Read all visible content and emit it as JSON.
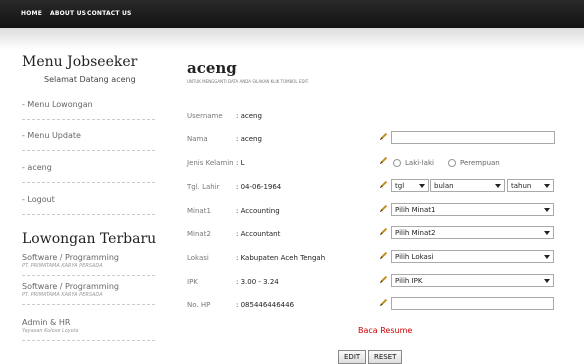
{
  "nav": [
    "HOME",
    "ABOUT US",
    "CONTACT US"
  ],
  "sidebar": {
    "title": "Menu Jobseeker",
    "subtitle": "Selamat Datang aceng",
    "items": [
      "- Menu Lowongan",
      "- Menu Update",
      "- aceng",
      "- Logout"
    ]
  },
  "lowongan": {
    "title": "Lowongan Terbaru",
    "jobs": [
      {
        "title": "Software / Programming",
        "company": "PT. PRIMATAMA KARYA PERSADA"
      },
      {
        "title": "Software / Programming",
        "company": "PT. PRIMATAMA KARYA PERSADA"
      },
      {
        "title": "Admin & HR",
        "company": "Yayasan Kolose Loyola"
      }
    ]
  },
  "main": {
    "title": "aceng",
    "note": "UNTUK MENGGANTI DATA ANDA SILAKAN KLIK TOMBOL EDIT.",
    "fields": [
      {
        "label": "Username",
        "value": ": aceng"
      },
      {
        "label": "Nama",
        "value": ": aceng"
      },
      {
        "label": "Jenis Kelamin",
        "value": ": L"
      },
      {
        "label": "Tgl. Lahir",
        "value": ": 04-06-1964"
      },
      {
        "label": "Minat1",
        "value": ": Accounting"
      },
      {
        "label": "Minat2",
        "value": ": Accountant"
      },
      {
        "label": "Lokasi",
        "value": ": Kabupaten Aceh Tengah"
      },
      {
        "label": "IPK",
        "value": ": 3.00 - 3.24"
      },
      {
        "label": "No. HP",
        "value": ": 085446446446"
      }
    ],
    "gender_options": [
      "Laki-laki",
      "Perempuan"
    ],
    "date_selects": [
      "tgl",
      "bulan",
      "tahun"
    ],
    "selects": {
      "minat1": "Pilih Minat1",
      "minat2": "Pilih Minat2",
      "lokasi": "Pilih Lokasi",
      "ipk": "Pilih IPK"
    },
    "resume_link": "Baca Resume",
    "edit_button": "EDIT",
    "reset_button": "RESET"
  },
  "colors": {
    "topbar": "#1a1a1a",
    "link": "#cc0000",
    "pencil": "#c08a1e"
  }
}
